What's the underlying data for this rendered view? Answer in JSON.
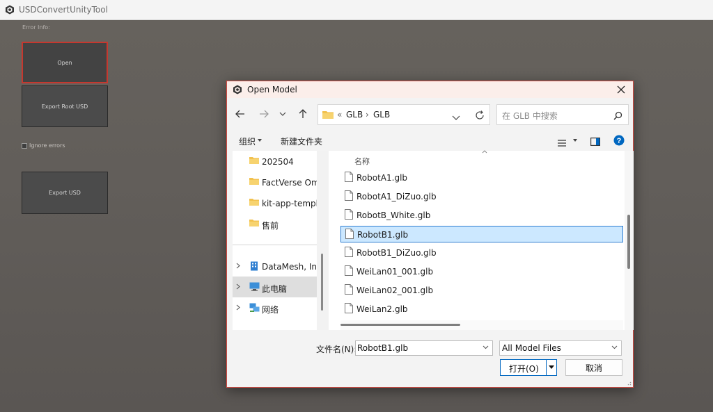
{
  "app": {
    "title": "USDConvertUnityTool",
    "error_info": "Error Info:",
    "buttons": {
      "open": "Open",
      "export_root": "Export Root USD",
      "export": "Export USD"
    },
    "toggle_label": "Ignore errors"
  },
  "dialog": {
    "title": "Open Model",
    "address": {
      "overflow": "«",
      "crumbs": [
        "GLB",
        "GLB"
      ],
      "separator": "›"
    },
    "search_placeholder": "在 GLB 中搜索",
    "toolbar": {
      "organize": "组织",
      "new_folder": "新建文件夹"
    },
    "nav_pane": {
      "quick_items": [
        "202504",
        "FactVerse Omn",
        "kit-app-templa",
        "售前"
      ],
      "tree_items": [
        "DataMesh, Inc",
        "此电脑",
        "网络"
      ],
      "selected_tree_index": 1
    },
    "file_list": {
      "column_name": "名称",
      "files": [
        "RobotA1.glb",
        "RobotA1_DiZuo.glb",
        "RobotB_White.glb",
        "RobotB1.glb",
        "RobotB1_DiZuo.glb",
        "WeiLan01_001.glb",
        "WeiLan02_001.glb",
        "WeiLan2.glb"
      ],
      "selected_index": 3
    },
    "filename_label": "文件名(N):",
    "filename_value": "RobotB1.glb",
    "filetype_value": "All Model Files",
    "open_button": "打开(O)",
    "cancel_button": "取消"
  },
  "colors": {
    "accent": "#0067c0",
    "selection_bg": "#cce8ff",
    "dialog_border": "#d54b43",
    "folder": "#f2c14e"
  }
}
